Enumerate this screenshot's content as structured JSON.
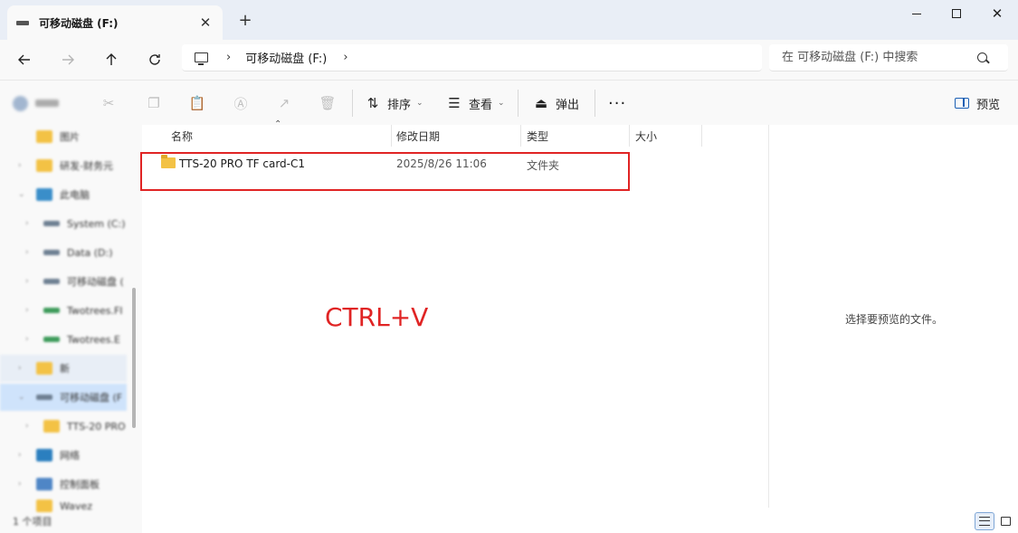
{
  "window": {
    "tab_title": "可移动磁盘 (F:)",
    "tab_close": "✕",
    "new_tab": "+"
  },
  "address": {
    "crumb": "可移动磁盘 (F:)",
    "separator": "›"
  },
  "search": {
    "placeholder": "在 可移动磁盘 (F:) 中搜索"
  },
  "toolbar": {
    "sort_label": "排序",
    "view_label": "查看",
    "eject_label": "弹出",
    "more_label": "···",
    "preview_label": "预览"
  },
  "columns": {
    "name": "名称",
    "modified": "修改日期",
    "type": "类型",
    "size": "大小"
  },
  "files": [
    {
      "name": "TTS-20 PRO TF card-C1",
      "modified": "2025/8/26 11:06",
      "type": "文件夹",
      "size": ""
    }
  ],
  "annotation": {
    "text": "CTRL+V",
    "color": "#e02424"
  },
  "preview_pane": {
    "message": "选择要预览的文件。"
  },
  "sidebar": {
    "items": [
      {
        "label": "图片",
        "icon": "folder-icon"
      },
      {
        "label": "研发-财务元",
        "icon": "folder-icon"
      },
      {
        "label": "此电脑",
        "icon": "pc-icon"
      },
      {
        "label": "System (C:)",
        "icon": "drive-icon"
      },
      {
        "label": "Data (D:)",
        "icon": "drive-icon"
      },
      {
        "label": "可移动磁盘 (",
        "icon": "drive-icon"
      },
      {
        "label": "Twotrees.FI",
        "icon": "drive-icon"
      },
      {
        "label": "Twotrees.E",
        "icon": "drive-icon"
      },
      {
        "label": "新",
        "icon": "folder-icon"
      },
      {
        "label": "可移动磁盘 (F",
        "icon": "drive-icon"
      },
      {
        "label": "TTS-20 PRO",
        "icon": "folder-icon"
      },
      {
        "label": "网络",
        "icon": "network-icon"
      },
      {
        "label": "控制面板",
        "icon": "control-panel-icon"
      },
      {
        "label": "Wavez",
        "icon": "folder-icon"
      }
    ],
    "status": "1 个项目"
  },
  "colors": {
    "accent": "#1a5fb4",
    "highlight": "#e02424",
    "folder": "#f3c245"
  }
}
